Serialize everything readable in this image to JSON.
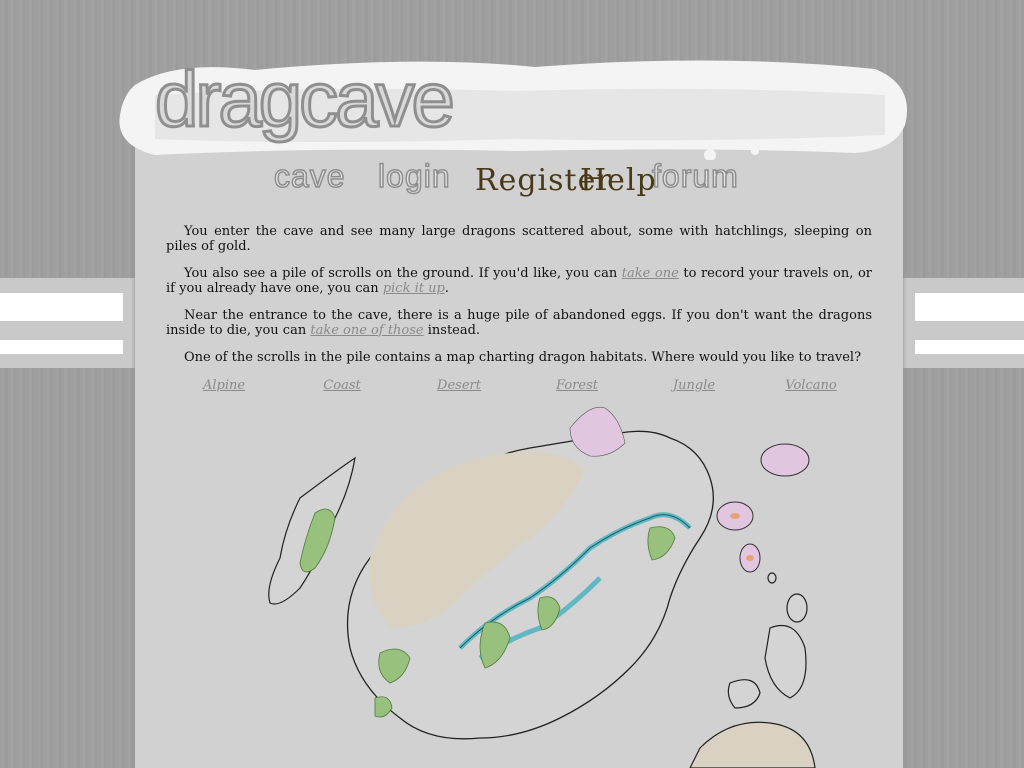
{
  "site": {
    "logo_text": "dragcave"
  },
  "nav": {
    "cave": "cave",
    "login": "login",
    "register": "Register",
    "help": "Help",
    "forum": "forum"
  },
  "content": {
    "p1": "You enter the cave and see many large dragons scattered about, some with hatchlings, sleeping on piles of gold.",
    "p2_before": "You also see a pile of scrolls on the ground. If you'd like, you can ",
    "p2_link1": "take one",
    "p2_middle": " to record your travels on, or if you already have one, you can ",
    "p2_link2": "pick it up",
    "p2_after": ".",
    "p3_before": "Near the entrance to the cave, there is a huge pile of abandoned eggs. If you don't want the dragons inside to die, you can ",
    "p3_link": "take one of those",
    "p3_after": " instead.",
    "p4": "One of the scrolls in the pile contains a map charting dragon habitats. Where would you like to travel?"
  },
  "habitats": [
    "Alpine",
    "Coast",
    "Desert",
    "Forest",
    "Jungle",
    "Volcano"
  ],
  "colors": {
    "background": "#a0a0a0",
    "container": "#d1d1d1",
    "link": "#8a8a8a",
    "nav_dark": "#4a3916"
  }
}
